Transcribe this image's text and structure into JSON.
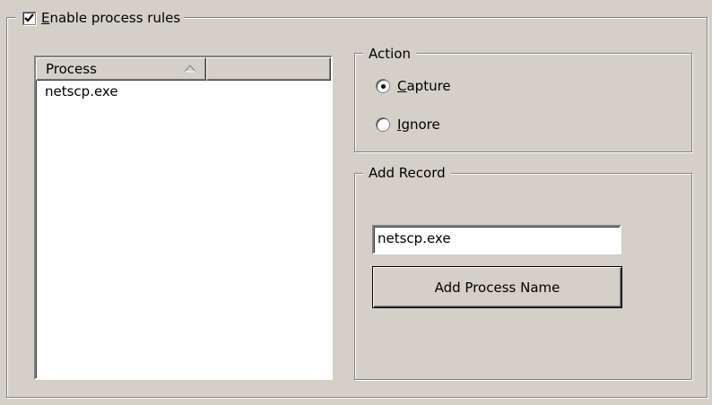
{
  "rules": {
    "enable_label": "Enable process rules",
    "enabled": true
  },
  "list": {
    "columns": [
      "Process",
      ""
    ],
    "sort_indicator": "sort-ascending-icon",
    "rows": [
      "netscp.exe"
    ]
  },
  "action": {
    "title": "Action",
    "options": [
      {
        "label": "Capture",
        "selected": true
      },
      {
        "label": "Ignore",
        "selected": false
      }
    ]
  },
  "add_record": {
    "title": "Add Record",
    "input_value": "netscp.exe",
    "button_label": "Add Process Name"
  }
}
